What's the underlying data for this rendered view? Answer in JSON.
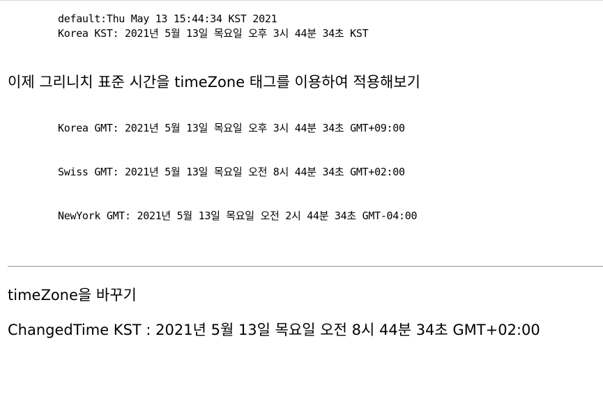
{
  "lines": {
    "default": "default:Thu May 13 15:44:34 KST 2021",
    "korea_kst": "Korea KST: 2021년 5월 13일 목요일 오후 3시 44분 34초 KST",
    "gmt_heading": "이제 그리니치 표준 시간을 timeZone 태그를 이용하여 적용해보기",
    "korea_gmt": "Korea GMT: 2021년 5월 13일 목요일 오후 3시 44분 34초 GMT+09:00",
    "swiss_gmt": "Swiss GMT: 2021년 5월 13일 목요일 오전 8시 44분 34초 GMT+02:00",
    "newyork_gmt": "NewYork GMT: 2021년 5월 13일 목요일 오전 2시 44분 34초 GMT-04:00",
    "change_heading": "timeZone을 바꾸기",
    "changed_time": "ChangedTime KST : 2021년 5월 13일 목요일 오전 8시 44분 34초 GMT+02:00"
  }
}
